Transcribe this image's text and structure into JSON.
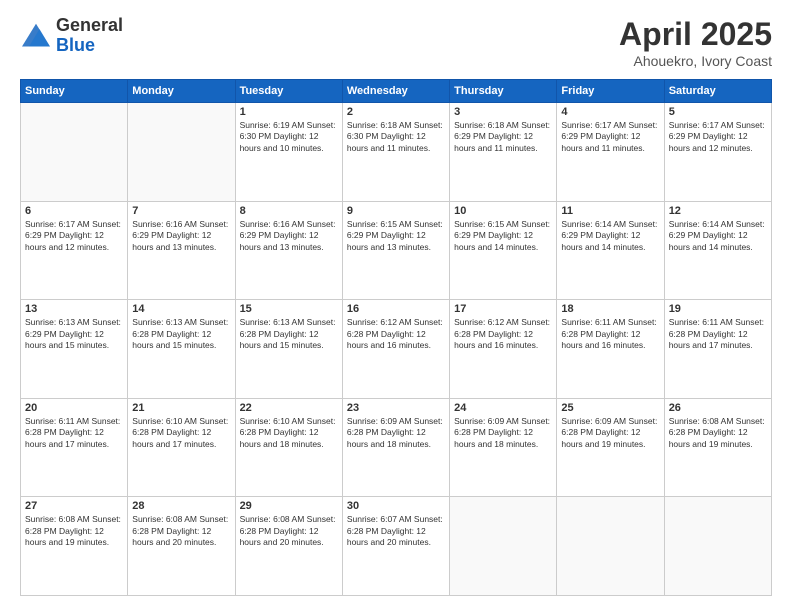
{
  "header": {
    "logo_general": "General",
    "logo_blue": "Blue",
    "month_year": "April 2025",
    "location": "Ahouekro, Ivory Coast"
  },
  "weekdays": [
    "Sunday",
    "Monday",
    "Tuesday",
    "Wednesday",
    "Thursday",
    "Friday",
    "Saturday"
  ],
  "weeks": [
    [
      {
        "day": "",
        "info": ""
      },
      {
        "day": "",
        "info": ""
      },
      {
        "day": "1",
        "info": "Sunrise: 6:19 AM\nSunset: 6:30 PM\nDaylight: 12 hours and 10 minutes."
      },
      {
        "day": "2",
        "info": "Sunrise: 6:18 AM\nSunset: 6:30 PM\nDaylight: 12 hours and 11 minutes."
      },
      {
        "day": "3",
        "info": "Sunrise: 6:18 AM\nSunset: 6:29 PM\nDaylight: 12 hours and 11 minutes."
      },
      {
        "day": "4",
        "info": "Sunrise: 6:17 AM\nSunset: 6:29 PM\nDaylight: 12 hours and 11 minutes."
      },
      {
        "day": "5",
        "info": "Sunrise: 6:17 AM\nSunset: 6:29 PM\nDaylight: 12 hours and 12 minutes."
      }
    ],
    [
      {
        "day": "6",
        "info": "Sunrise: 6:17 AM\nSunset: 6:29 PM\nDaylight: 12 hours and 12 minutes."
      },
      {
        "day": "7",
        "info": "Sunrise: 6:16 AM\nSunset: 6:29 PM\nDaylight: 12 hours and 13 minutes."
      },
      {
        "day": "8",
        "info": "Sunrise: 6:16 AM\nSunset: 6:29 PM\nDaylight: 12 hours and 13 minutes."
      },
      {
        "day": "9",
        "info": "Sunrise: 6:15 AM\nSunset: 6:29 PM\nDaylight: 12 hours and 13 minutes."
      },
      {
        "day": "10",
        "info": "Sunrise: 6:15 AM\nSunset: 6:29 PM\nDaylight: 12 hours and 14 minutes."
      },
      {
        "day": "11",
        "info": "Sunrise: 6:14 AM\nSunset: 6:29 PM\nDaylight: 12 hours and 14 minutes."
      },
      {
        "day": "12",
        "info": "Sunrise: 6:14 AM\nSunset: 6:29 PM\nDaylight: 12 hours and 14 minutes."
      }
    ],
    [
      {
        "day": "13",
        "info": "Sunrise: 6:13 AM\nSunset: 6:29 PM\nDaylight: 12 hours and 15 minutes."
      },
      {
        "day": "14",
        "info": "Sunrise: 6:13 AM\nSunset: 6:28 PM\nDaylight: 12 hours and 15 minutes."
      },
      {
        "day": "15",
        "info": "Sunrise: 6:13 AM\nSunset: 6:28 PM\nDaylight: 12 hours and 15 minutes."
      },
      {
        "day": "16",
        "info": "Sunrise: 6:12 AM\nSunset: 6:28 PM\nDaylight: 12 hours and 16 minutes."
      },
      {
        "day": "17",
        "info": "Sunrise: 6:12 AM\nSunset: 6:28 PM\nDaylight: 12 hours and 16 minutes."
      },
      {
        "day": "18",
        "info": "Sunrise: 6:11 AM\nSunset: 6:28 PM\nDaylight: 12 hours and 16 minutes."
      },
      {
        "day": "19",
        "info": "Sunrise: 6:11 AM\nSunset: 6:28 PM\nDaylight: 12 hours and 17 minutes."
      }
    ],
    [
      {
        "day": "20",
        "info": "Sunrise: 6:11 AM\nSunset: 6:28 PM\nDaylight: 12 hours and 17 minutes."
      },
      {
        "day": "21",
        "info": "Sunrise: 6:10 AM\nSunset: 6:28 PM\nDaylight: 12 hours and 17 minutes."
      },
      {
        "day": "22",
        "info": "Sunrise: 6:10 AM\nSunset: 6:28 PM\nDaylight: 12 hours and 18 minutes."
      },
      {
        "day": "23",
        "info": "Sunrise: 6:09 AM\nSunset: 6:28 PM\nDaylight: 12 hours and 18 minutes."
      },
      {
        "day": "24",
        "info": "Sunrise: 6:09 AM\nSunset: 6:28 PM\nDaylight: 12 hours and 18 minutes."
      },
      {
        "day": "25",
        "info": "Sunrise: 6:09 AM\nSunset: 6:28 PM\nDaylight: 12 hours and 19 minutes."
      },
      {
        "day": "26",
        "info": "Sunrise: 6:08 AM\nSunset: 6:28 PM\nDaylight: 12 hours and 19 minutes."
      }
    ],
    [
      {
        "day": "27",
        "info": "Sunrise: 6:08 AM\nSunset: 6:28 PM\nDaylight: 12 hours and 19 minutes."
      },
      {
        "day": "28",
        "info": "Sunrise: 6:08 AM\nSunset: 6:28 PM\nDaylight: 12 hours and 20 minutes."
      },
      {
        "day": "29",
        "info": "Sunrise: 6:08 AM\nSunset: 6:28 PM\nDaylight: 12 hours and 20 minutes."
      },
      {
        "day": "30",
        "info": "Sunrise: 6:07 AM\nSunset: 6:28 PM\nDaylight: 12 hours and 20 minutes."
      },
      {
        "day": "",
        "info": ""
      },
      {
        "day": "",
        "info": ""
      },
      {
        "day": "",
        "info": ""
      }
    ]
  ]
}
